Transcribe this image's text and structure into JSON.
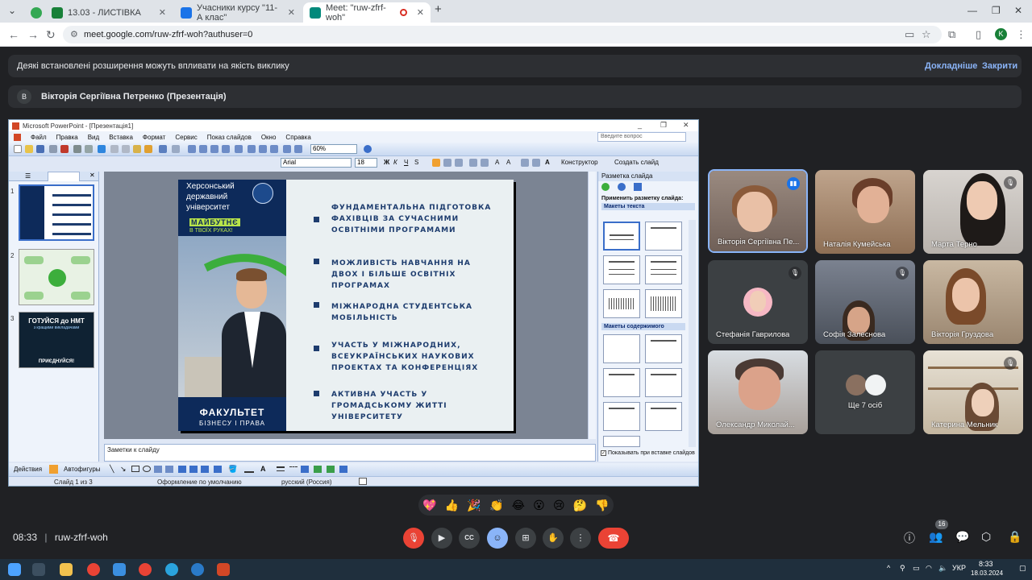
{
  "browser": {
    "tabs": [
      {
        "title": "13.03 - ЛИСТІВКА",
        "favicon_color": "#188038"
      },
      {
        "title": "Учасники курсу \"11-А клас\"",
        "favicon_color": "#1a73e8"
      },
      {
        "title": "Meet: \"ruw-zfrf-woh\"",
        "favicon_color": "#00897b"
      }
    ],
    "url": "meet.google.com/ruw-zfrf-woh?authuser=0",
    "profile_initial": "K"
  },
  "banner": {
    "text": "Деякі встановлені розширення можуть впливати на якість виклику",
    "learn_more": "Докладніше",
    "close": "Закрити"
  },
  "presenter": {
    "initial": "В",
    "label": "Вікторія Сергіївна Петренко (Презентація)"
  },
  "ppt": {
    "title": "Microsoft PowerPoint - [Презентація1]",
    "menu": [
      "Файл",
      "Правка",
      "Вид",
      "Вставка",
      "Формат",
      "Сервис",
      "Показ слайдов",
      "Окно",
      "Справка"
    ],
    "ask_placeholder": "Введите вопрос",
    "zoom": "60%",
    "font": "Arial",
    "font_size": "18",
    "constructor": "Конструктор",
    "new_slide": "Создать слайд",
    "notes_placeholder": "Заметки к слайду",
    "taskpane_title": "Разметка слайда",
    "apply_layout": "Применить разметку слайда:",
    "text_layouts": "Макеты текста",
    "content_layouts": "Макеты содержимого",
    "show_on_insert": "Показывать при вставке слайдов",
    "actions": "Действия",
    "autoshapes": "Автофигуры",
    "status": {
      "slide": "Слайд 1 из 3",
      "design": "Оформление по умолчанию",
      "lang": "русский (Россия)"
    },
    "thumb_numbers": [
      "1",
      "2",
      "3"
    ],
    "thumb3_title": "ГОТУЙСЯ до НМТ",
    "thumb3_sub": "з кращими викладачами",
    "thumb3_cta": "ПРИЄДНУЙСЯ!"
  },
  "slide": {
    "university": "Херсонський державний університет",
    "slogan_main": "МАЙБУТНЄ",
    "slogan_sub": "В ТВОЇХ РУКАХ!",
    "faculty_line1": "ФАКУЛЬТЕТ",
    "faculty_line2": "БІЗНЕСУ І ПРАВА",
    "bullets": [
      "ФУНДАМЕНТАЛЬНА ПІДГОТОВКА ФАХІВЦІВ ЗА СУЧАСНИМИ ОСВІТНІМИ ПРОГРАМАМИ",
      "МОЖЛИВІСТЬ НАВЧАННЯ НА ДВОХ І БІЛЬШЕ ОСВІТНІХ ПРОГРАМАХ",
      "МІЖНАРОДНА СТУДЕНТСЬКА МОБІЛЬНІСТЬ",
      "УЧАСТЬ У МІЖНАРОДНИХ, ВСЕУКРАЇНСЬКИХ НАУКОВИХ ПРОЕКТАХ ТА КОНФЕРЕНЦІЯХ",
      "АКТИВНА УЧАСТЬ У ГРОМАДСЬКОМУ ЖИТТІ УНІВЕРСИТЕТУ"
    ]
  },
  "participants": [
    {
      "name": "Вікторія Сергіївна Пе...",
      "speaking": true
    },
    {
      "name": "Наталія Кумейська",
      "muted": false
    },
    {
      "name": "Марта Терно",
      "muted": true
    },
    {
      "name": "Стефанія Гаврилова",
      "muted": true
    },
    {
      "name": "Софія Залеснова",
      "muted": true
    },
    {
      "name": "Вікторія Груздова",
      "muted": false
    },
    {
      "name": "Олександр Миколай...",
      "muted": false
    },
    {
      "name": "Ще 7 осіб"
    },
    {
      "name": "Катерина Мельник",
      "muted": true
    }
  ],
  "reactions": [
    "💖",
    "👍",
    "🎉",
    "👏",
    "😂",
    "😮",
    "😢",
    "🤔",
    "👎"
  ],
  "meeting": {
    "time": "08:33",
    "code": "ruw-zfrf-woh",
    "participant_count": "16"
  },
  "taskbar": {
    "lang": "УКР",
    "time": "8:33",
    "date": "18.03.2024"
  }
}
